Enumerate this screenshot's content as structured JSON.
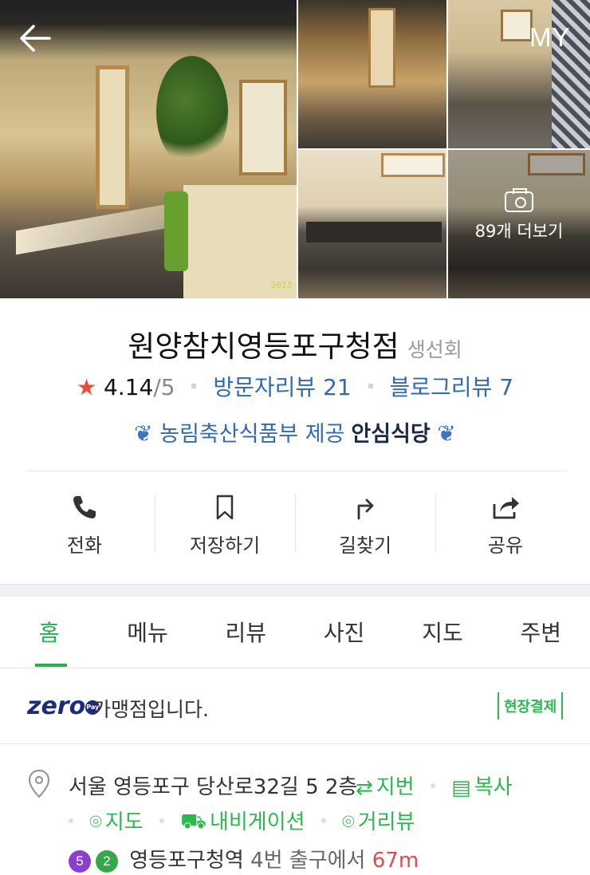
{
  "header": {
    "back_label": "←",
    "my_label": "MY"
  },
  "photos": {
    "more_label": "89개 더보기",
    "stamp": "2013"
  },
  "place": {
    "name": "원양참치영등포구청점",
    "category": "생선회",
    "rating": "4.14",
    "rating_max": "/5",
    "visitor_reviews": "방문자리뷰 21",
    "blog_reviews": "블로그리뷰 7",
    "cert_provider": "농림축산식품부 제공",
    "cert_badge": "안심식당"
  },
  "actions": [
    {
      "label": "전화",
      "icon": "phone-icon"
    },
    {
      "label": "저장하기",
      "icon": "bookmark-icon"
    },
    {
      "label": "길찾기",
      "icon": "directions-icon"
    },
    {
      "label": "공유",
      "icon": "share-icon"
    }
  ],
  "tabs": [
    "홈",
    "메뉴",
    "리뷰",
    "사진",
    "지도",
    "주변"
  ],
  "zeropay": {
    "brand": "zero",
    "pay_mark": "Pay",
    "text": "가맹점입니다.",
    "onsite_label": "현장결제"
  },
  "address": {
    "text": "서울 영등포구 당산로32길 5 2층",
    "jibun_label": "지번",
    "copy_label": "복사",
    "map_label": "지도",
    "navi_label": "내비게이션",
    "street_label": "거리뷰",
    "line5": "5",
    "line2": "2",
    "station": "영등포구청역",
    "exit": "4번 출구에서",
    "distance": "67m"
  },
  "colors": {
    "accent": "#22b14c",
    "link": "#2f6ab6",
    "star": "#e94b3c"
  }
}
